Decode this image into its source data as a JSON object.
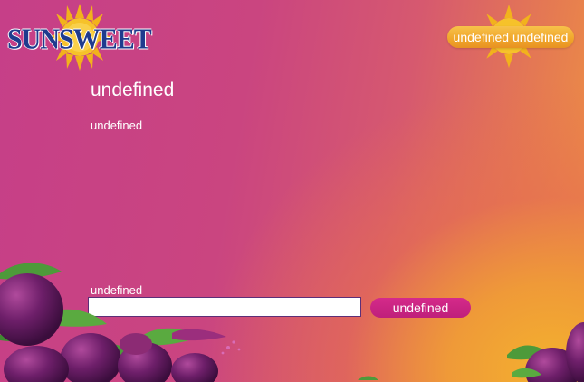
{
  "brand": {
    "logo_text": "SUNSWEET"
  },
  "header": {
    "user_badge": "undefined undefined"
  },
  "main": {
    "title": "undefined",
    "subtitle": "undefined"
  },
  "form": {
    "field_label": "undefined",
    "input_value": "",
    "submit_label": "undefined"
  },
  "colors": {
    "background_pink": "#c93f86",
    "background_orange": "#f4b12e",
    "logo_blue": "#1f3b8e",
    "badge_gold": "#f0a52a",
    "button_magenta": "#c8237f"
  },
  "icons": [
    "sun-icon",
    "plum-fruit-illustration"
  ]
}
